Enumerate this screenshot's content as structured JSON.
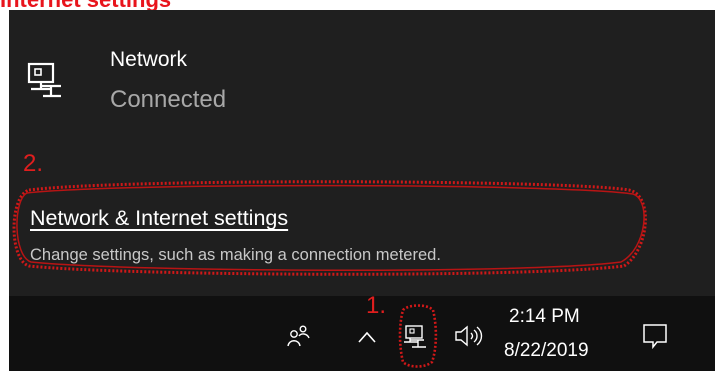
{
  "caption": {
    "highlight": "Internet settings",
    "rest": "\""
  },
  "network": {
    "name": "Network",
    "status": "Connected",
    "icon": "ethernet-monitor-icon"
  },
  "annotations": {
    "step2": "2.",
    "step1": "1.",
    "color": "#e01e1e"
  },
  "settings": {
    "link_label": "Network & Internet settings",
    "description": "Change settings, such as making a connection metered."
  },
  "taskbar": {
    "icons": [
      "people-icon",
      "chevron-up-icon",
      "network-tray-icon",
      "volume-icon",
      "action-center-icon"
    ],
    "time": "2:14 PM",
    "date": "8/22/2019"
  },
  "colors": {
    "flyout_bg": "#1f1f1f",
    "taskbar_bg": "#101010",
    "annotation_red": "#e01e1e"
  }
}
